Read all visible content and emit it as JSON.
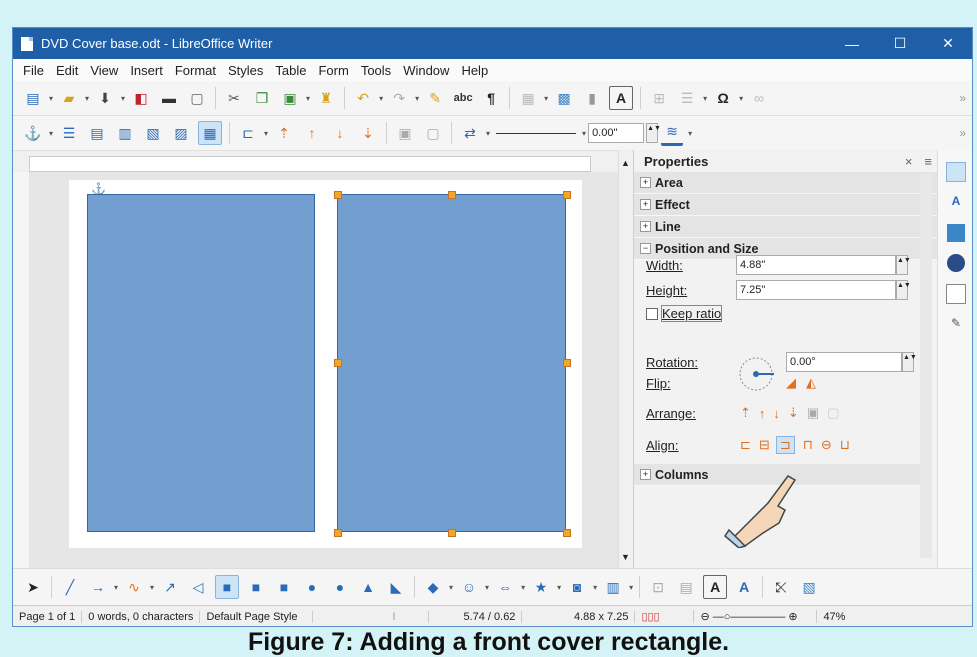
{
  "window": {
    "title": "DVD Cover base.odt - LibreOffice Writer",
    "min": "—",
    "max": "☐",
    "close": "✕"
  },
  "menu": [
    "File",
    "Edit",
    "View",
    "Insert",
    "Format",
    "Styles",
    "Table",
    "Form",
    "Tools",
    "Window",
    "Help"
  ],
  "frame_toolbar": {
    "spacing_value": "0.00\""
  },
  "sidebar": {
    "title": "Properties",
    "sections": {
      "area": "Area",
      "effect": "Effect",
      "line": "Line",
      "position": "Position and Size",
      "columns": "Columns"
    },
    "width_label": "Width:",
    "width_value": "4.88\"",
    "height_label": "Height:",
    "height_value": "7.25\"",
    "keep_ratio": "Keep ratio",
    "rotation_label": "Rotation:",
    "rotation_value": "0.00°",
    "flip_label": "Flip:",
    "arrange_label": "Arrange:",
    "align_label": "Align:"
  },
  "status": {
    "page": "Page 1 of 1",
    "words": "0 words, 0 characters",
    "style": "Default Page Style",
    "position": "5.74 / 0.62",
    "size": "4.88 x 7.25",
    "zoom": "47%"
  },
  "caption": "Figure 7: Adding a front cover rectangle.",
  "colors": {
    "titlebar": "#1f5fa8",
    "shape_fill": "#729fcf",
    "handle": "#f5a623",
    "page_bg": "#d4f3f7"
  }
}
